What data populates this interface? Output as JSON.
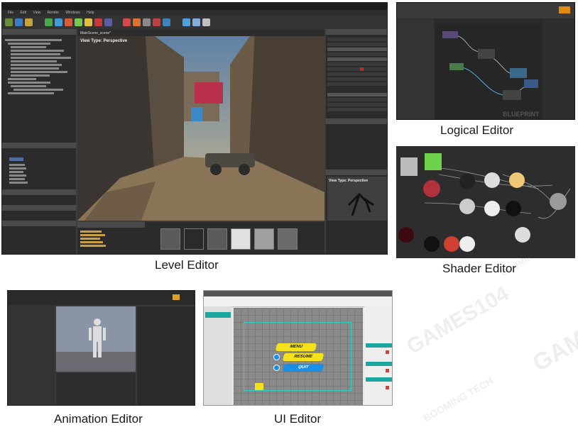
{
  "captions": {
    "level": "Level Editor",
    "logical": "Logical Editor",
    "shader": "Shader Editor",
    "animation": "Animation Editor",
    "ui": "UI Editor"
  },
  "level_editor": {
    "menu": [
      "File",
      "Edit",
      "View",
      "Render",
      "Windows",
      "Help"
    ],
    "viewport_tab": "MainScene_scene*",
    "viewport_label": "View Type: Perspective"
  },
  "logical_editor": {
    "watermark": "BLUEPRINT"
  },
  "ui_editor": {
    "buttons": {
      "menu": "MENU",
      "resume": "RESUME",
      "quit": "QUIT"
    }
  },
  "watermarks": [
    "BOOMING TECH",
    "GAMES104",
    "GAMES"
  ],
  "colors": {
    "ui_yellow": "#f5e21c",
    "ui_blue": "#1a8fe8",
    "ui_teal_bar": "#1aa7a0",
    "blueprint_bg": "#262626"
  }
}
